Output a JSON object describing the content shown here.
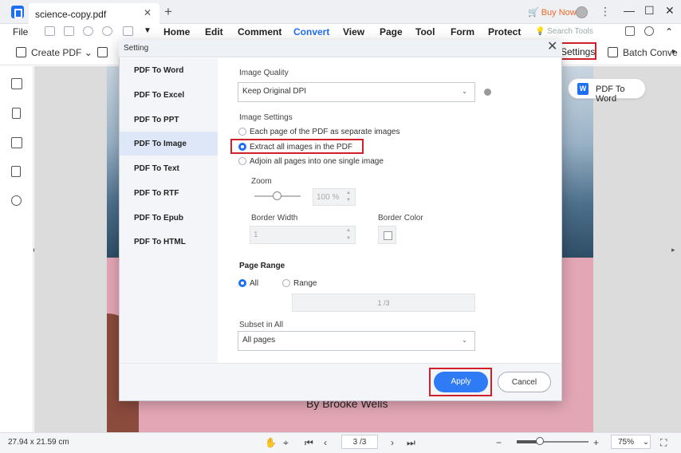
{
  "titlebar": {
    "tab_title": "science-copy.pdf",
    "tab_close": "✕",
    "tab_add": "+",
    "buy_now": "Buy Now",
    "kebab": "⋮",
    "minimize": "—",
    "maximize": "☐",
    "close": "✕"
  },
  "menubar": {
    "file": "File",
    "items": [
      "Home",
      "Edit",
      "Comment",
      "Convert",
      "View",
      "Page",
      "Tool",
      "Form",
      "Protect"
    ],
    "active_item": "Convert",
    "search_placeholder": "Search Tools"
  },
  "toolbar": {
    "create_pdf": "Create PDF",
    "settings": "Settings",
    "batch_convert": "Batch Conve",
    "more_arrow": "▸"
  },
  "canvas": {
    "pdf_to_word": "PDF To Word",
    "word_icon_letter": "W",
    "author": "By Brooke Wells"
  },
  "statusbar": {
    "dimensions": "27.94 x 21.59 cm",
    "page_indicator": "3 /3",
    "zoom": "75%"
  },
  "dialog": {
    "title": "Setting",
    "close": "✕",
    "nav": [
      "PDF To Word",
      "PDF To Excel",
      "PDF To PPT",
      "PDF To Image",
      "PDF To Text",
      "PDF To RTF",
      "PDF To Epub",
      "PDF To HTML"
    ],
    "active_nav": "PDF To Image",
    "image_quality_label": "Image Quality",
    "image_quality_value": "Keep Original DPI",
    "image_settings_label": "Image Settings",
    "options": [
      "Each page of the PDF as separate images",
      "Extract all images in the PDF",
      "Adjoin all pages into one single image"
    ],
    "selected_option": "Extract all images in the PDF",
    "zoom_label": "Zoom",
    "zoom_value": "100 %",
    "border_width_label": "Border Width",
    "border_width_value": "1",
    "border_color_label": "Border Color",
    "page_range_label": "Page Range",
    "range_all": "All",
    "range_range": "Range",
    "range_value": "1 /3",
    "subset_label": "Subset in All",
    "subset_value": "All pages",
    "apply": "Apply",
    "cancel": "Cancel"
  },
  "colors": {
    "accent": "#1f6ff2",
    "highlight": "#d0202a",
    "buy_now": "#f06a2a",
    "page_background": "#e3a6b5"
  }
}
